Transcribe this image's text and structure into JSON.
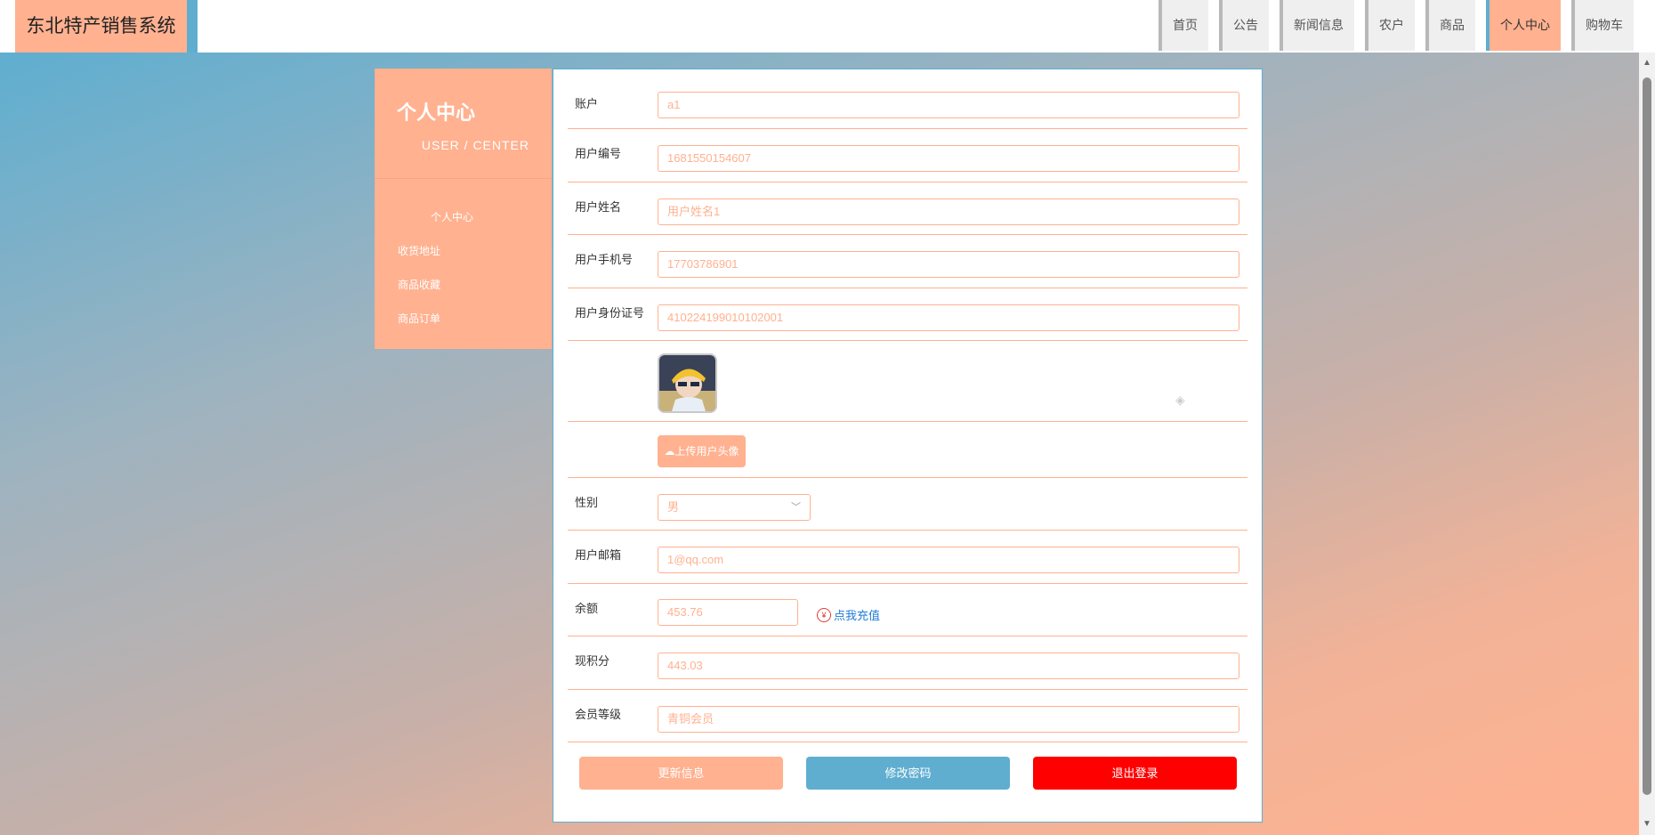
{
  "header": {
    "brand": "东北特产销售系统",
    "nav": [
      "首页",
      "公告",
      "新闻信息",
      "农户",
      "商品",
      "个人中心",
      "购物车"
    ],
    "nav_active": "个人中心"
  },
  "sidebar": {
    "title": "个人中心",
    "subtitle": "USER / CENTER",
    "items": [
      {
        "label": "个人中心",
        "active": true
      },
      {
        "label": "收货地址",
        "active": false
      },
      {
        "label": "商品收藏",
        "active": false
      },
      {
        "label": "商品订单",
        "active": false
      }
    ]
  },
  "form": {
    "account_label": "账户",
    "account_value": "a1",
    "userno_label": "用户编号",
    "userno_value": "1681550154607",
    "name_label": "用户姓名",
    "name_value": "用户姓名1",
    "phone_label": "用户手机号",
    "phone_value": "17703786901",
    "idcard_label": "用户身份证号",
    "idcard_value": "410224199010102001",
    "upload_label": "上传用户头像",
    "gender_label": "性别",
    "gender_value": "男",
    "email_label": "用户邮箱",
    "email_value": "1@qq.com",
    "balance_label": "余额",
    "balance_value": "453.76",
    "recharge_label": "点我充值",
    "points_label": "现积分",
    "points_value": "443.03",
    "level_label": "会员等级",
    "level_value": "青铜会员"
  },
  "buttons": {
    "update": "更新信息",
    "change_password": "修改密码",
    "logout": "退出登录"
  },
  "colors": {
    "accent": "#ffb190",
    "blue": "#5faed0",
    "danger": "#ff0000"
  }
}
